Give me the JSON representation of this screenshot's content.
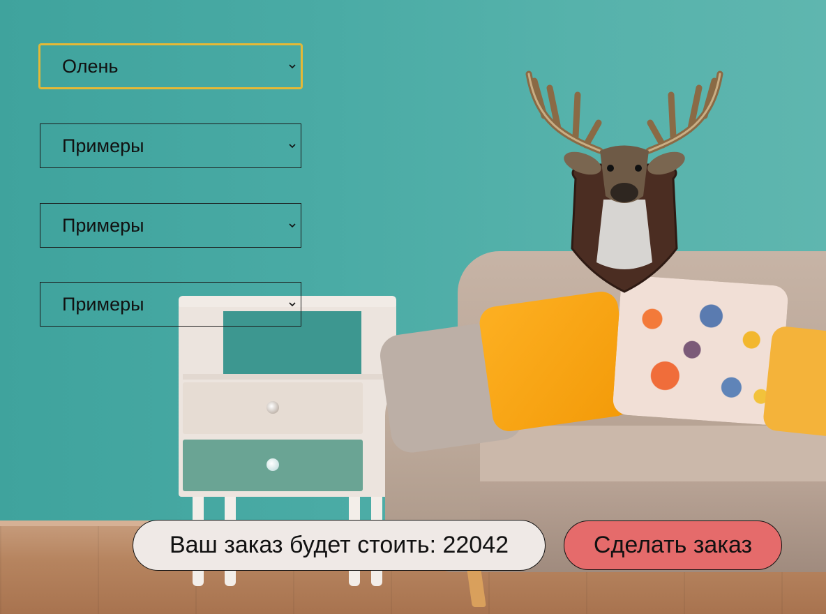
{
  "selects": [
    {
      "selected": "Олень",
      "focused": true
    },
    {
      "selected": "Примеры",
      "focused": false
    },
    {
      "selected": "Примеры",
      "focused": false
    },
    {
      "selected": "Примеры",
      "focused": false
    }
  ],
  "order": {
    "price_label": "Ваш заказ будет стоить: 22042",
    "button_label": "Сделать заказ"
  },
  "colors": {
    "wall": "#4aaba5",
    "focus_border": "#e5b936",
    "price_bg": "#efe9e6",
    "order_button": "#e56b6b"
  },
  "icons": {
    "select_arrow": "chevron-down-icon",
    "trophy": "deer-head-trophy"
  }
}
